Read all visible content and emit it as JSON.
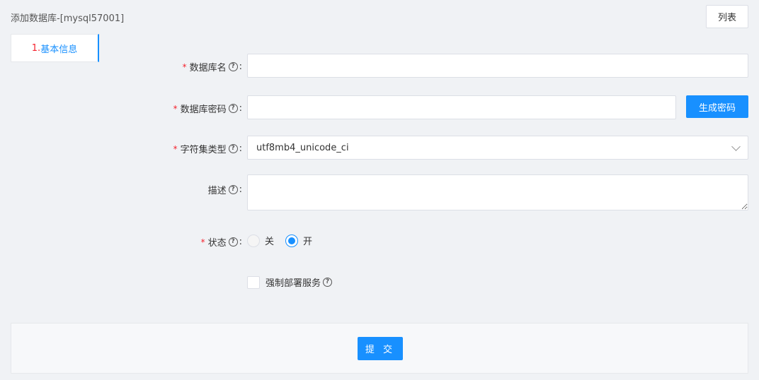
{
  "header": {
    "title": "添加数据库-[mysql57001]",
    "list_button": "列表"
  },
  "steps": [
    {
      "number": "1.",
      "label": "基本信息"
    }
  ],
  "form": {
    "db_name": {
      "label": "数据库名",
      "value": ""
    },
    "db_password": {
      "label": "数据库密码",
      "value": "",
      "generate_button": "生成密码"
    },
    "charset": {
      "label": "字符集类型",
      "selected": "utf8mb4_unicode_ci"
    },
    "description": {
      "label": "描述",
      "value": ""
    },
    "status": {
      "label": "状态",
      "options": [
        "关",
        "开"
      ],
      "selected": "开"
    },
    "force_deploy": {
      "label": "强制部署服务",
      "checked": false
    }
  },
  "footer": {
    "submit_button": "提 交"
  },
  "colors": {
    "accent": "#1890ff",
    "required": "#f5222d",
    "background": "#f0f2f5"
  }
}
